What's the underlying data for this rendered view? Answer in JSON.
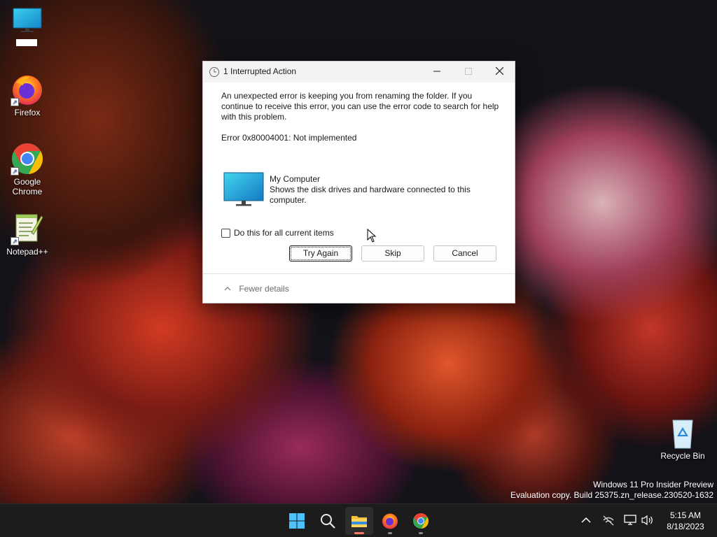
{
  "desktop": {
    "icons": [
      {
        "label": "",
        "icon": "monitor-icon"
      },
      {
        "label": "Firefox",
        "icon": "firefox-icon"
      },
      {
        "label": "Google Chrome",
        "line1": "Google",
        "line2": "Chrome",
        "icon": "chrome-icon"
      },
      {
        "label": "Notepad++",
        "icon": "notepadpp-icon"
      },
      {
        "label": "Recycle Bin",
        "icon": "recycle-bin-icon"
      }
    ]
  },
  "dialog": {
    "title": "1 Interrupted Action",
    "message": "An unexpected error is keeping you from renaming the folder. If you continue to receive this error, you can use the error code to search for help with this problem.",
    "error": "Error 0x80004001: Not implemented",
    "item": {
      "name": "My Computer",
      "description": "Shows the disk drives and hardware connected to this computer."
    },
    "checkbox_label": "Do this for all current items",
    "checkbox_checked": false,
    "buttons": {
      "try_again": "Try Again",
      "skip": "Skip",
      "cancel": "Cancel"
    },
    "details_toggle": "Fewer details"
  },
  "watermark": {
    "line1": "Windows 11 Pro Insider Preview",
    "line2": "Evaluation copy. Build 25375.zn_release.230520-1632"
  },
  "taskbar": {
    "apps": [
      "start-icon",
      "search-icon",
      "file-explorer-icon",
      "firefox-icon",
      "chrome-icon"
    ],
    "tray": [
      "chevron-up-icon",
      "network-off-icon",
      "display-icon",
      "speaker-icon"
    ],
    "clock": {
      "time": "5:15 AM",
      "date": "8/18/2023"
    }
  },
  "colors": {
    "accent": "#0067c0",
    "taskbar": "#1c1c1c",
    "dialog_bg": "#ffffff"
  }
}
